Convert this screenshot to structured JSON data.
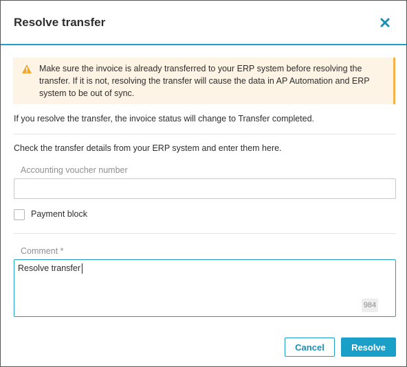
{
  "dialog": {
    "title": "Resolve transfer",
    "close_icon": "close-icon"
  },
  "warning": {
    "icon": "warning-icon",
    "text": "Make sure the invoice is already transferred to your ERP system before resolving the transfer. If it is not, resolving the transfer will cause the data in AP Automation and ERP system to be out of sync."
  },
  "info_text": "If you resolve the transfer, the invoice status will change to Transfer completed.",
  "details_text": "Check the transfer details from your ERP system and enter them here.",
  "voucher": {
    "label": "Accounting voucher number",
    "value": ""
  },
  "payment_block": {
    "label": "Payment block",
    "checked": false
  },
  "comment": {
    "label": "Comment *",
    "value": "Resolve transfer",
    "remaining": "984"
  },
  "buttons": {
    "cancel": "Cancel",
    "resolve": "Resolve"
  },
  "colors": {
    "accent": "#1aa0c8",
    "warning_bg": "#fdf4e6",
    "warning_accent": "#f5b24a"
  }
}
